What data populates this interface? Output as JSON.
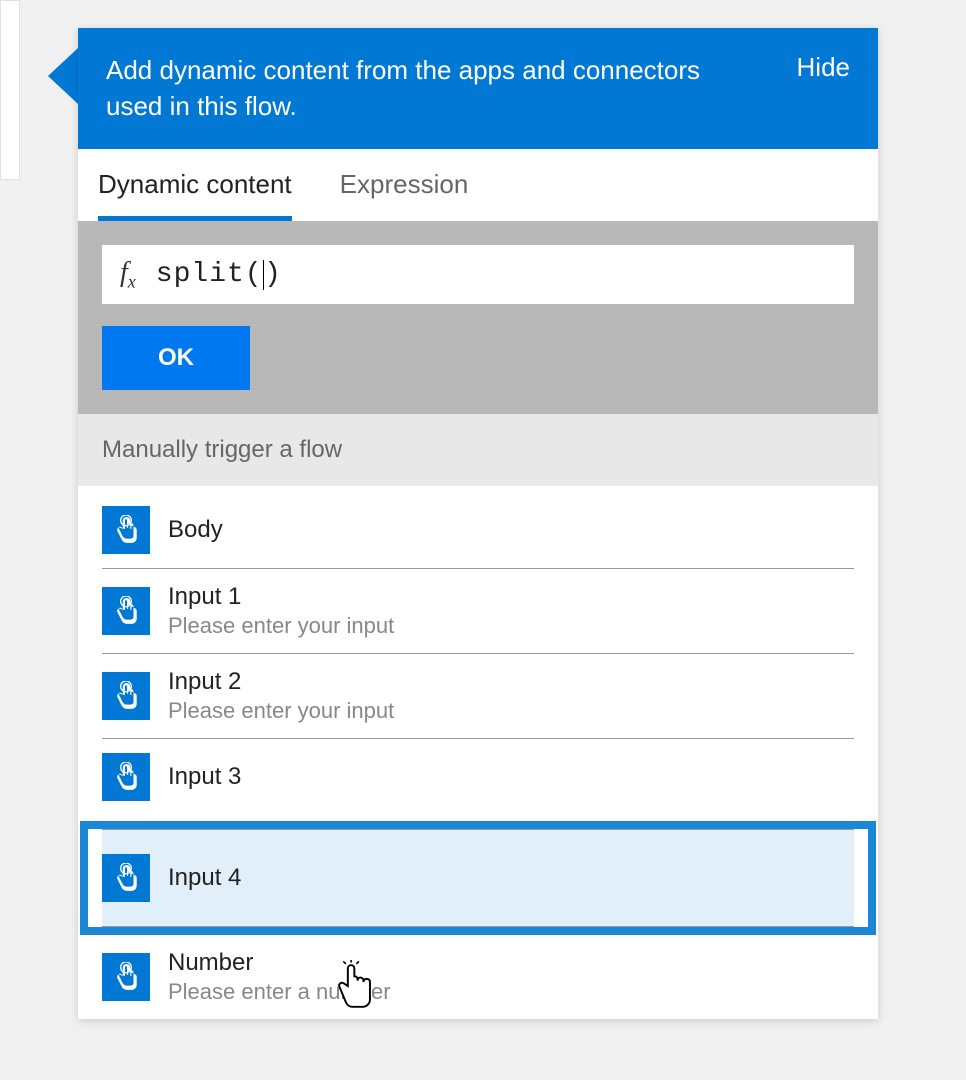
{
  "header": {
    "text": "Add dynamic content from the apps and connectors used in this flow.",
    "hide": "Hide"
  },
  "tabs": {
    "dynamic": "Dynamic content",
    "expression": "Expression"
  },
  "expr": {
    "fx": "fx",
    "value_left": "split(",
    "value_right": ")",
    "ok": "OK"
  },
  "section": {
    "trigger": "Manually trigger a flow"
  },
  "items": [
    {
      "title": "Body",
      "sub": ""
    },
    {
      "title": "Input 1",
      "sub": "Please enter your input"
    },
    {
      "title": "Input 2",
      "sub": "Please enter your input"
    },
    {
      "title": "Input 3",
      "sub": ""
    },
    {
      "title": "Input 4",
      "sub": ""
    },
    {
      "title": "Number",
      "sub": "Please enter a number"
    }
  ]
}
